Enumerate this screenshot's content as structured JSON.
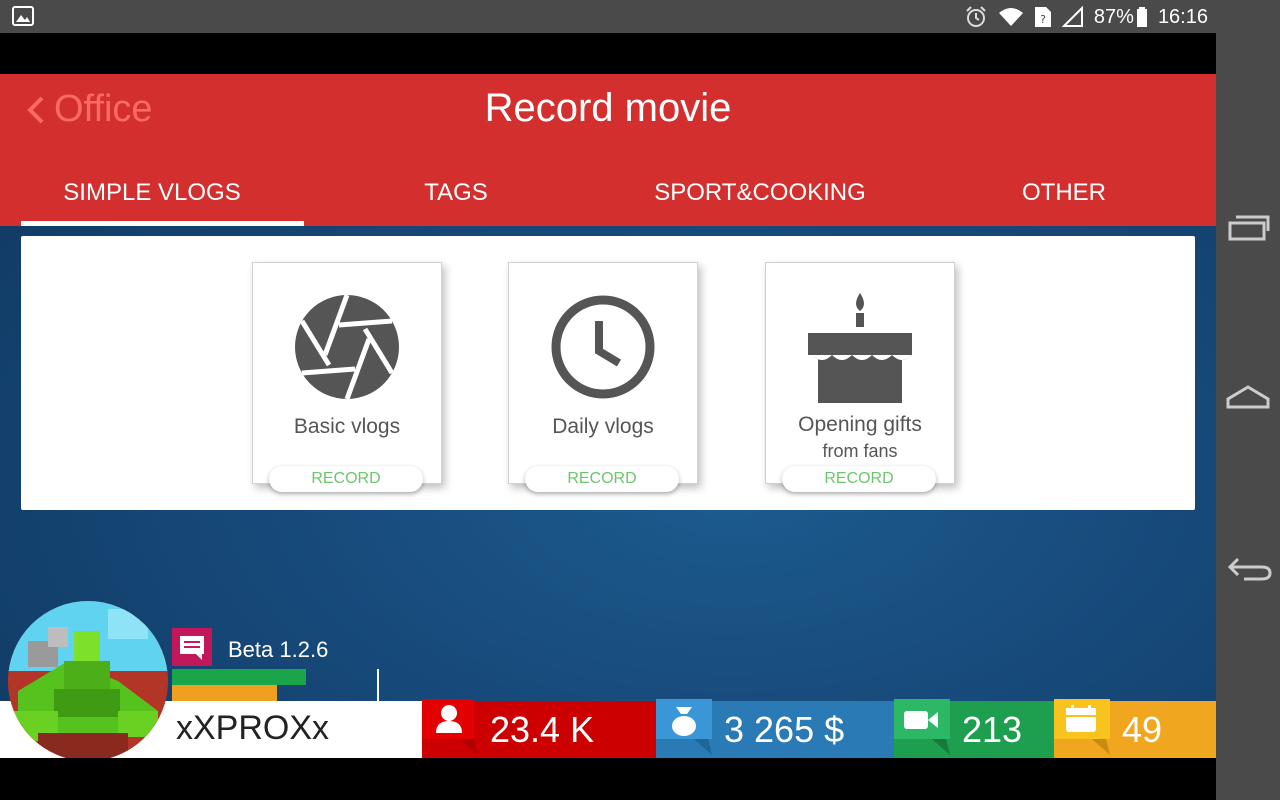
{
  "status_bar": {
    "battery": "87%",
    "time": "16:16",
    "icons": [
      "image-icon",
      "alarm-icon",
      "wifi-icon",
      "sim-icon",
      "signal-icon",
      "battery-icon"
    ]
  },
  "header": {
    "back_label": "Office",
    "title": "Record movie"
  },
  "tabs": [
    {
      "label": "SIMPLE VLOGS",
      "active": true
    },
    {
      "label": "TAGS",
      "active": false
    },
    {
      "label": "SPORT&COOKING",
      "active": false
    },
    {
      "label": "OTHER",
      "active": false
    }
  ],
  "cards": [
    {
      "label": "Basic vlogs",
      "sublabel": "",
      "button": "RECORD",
      "icon": "aperture-icon"
    },
    {
      "label": "Daily vlogs",
      "sublabel": "",
      "button": "RECORD",
      "icon": "clock-icon"
    },
    {
      "label": "Opening gifts",
      "sublabel": "from fans",
      "button": "RECORD",
      "icon": "cake-icon"
    }
  ],
  "player": {
    "version": "Beta 1.2.6",
    "username": "xXPROXx",
    "level_progress": 0.86,
    "secondary_progress": 0.68
  },
  "stats": [
    {
      "icon": "subscribers-icon",
      "value": "23.4 K",
      "color": "#cc0000"
    },
    {
      "icon": "money-bag-icon",
      "value": "3 265 $",
      "color": "#2a7bb5"
    },
    {
      "icon": "video-camera-icon",
      "value": "213",
      "color": "#1e9e4f"
    },
    {
      "icon": "calendar-icon",
      "value": "49",
      "color": "#f0a71f"
    }
  ],
  "colors": {
    "header_red": "#d32f2f",
    "back_text": "#ff6b60",
    "record_green": "#6cc66c"
  }
}
